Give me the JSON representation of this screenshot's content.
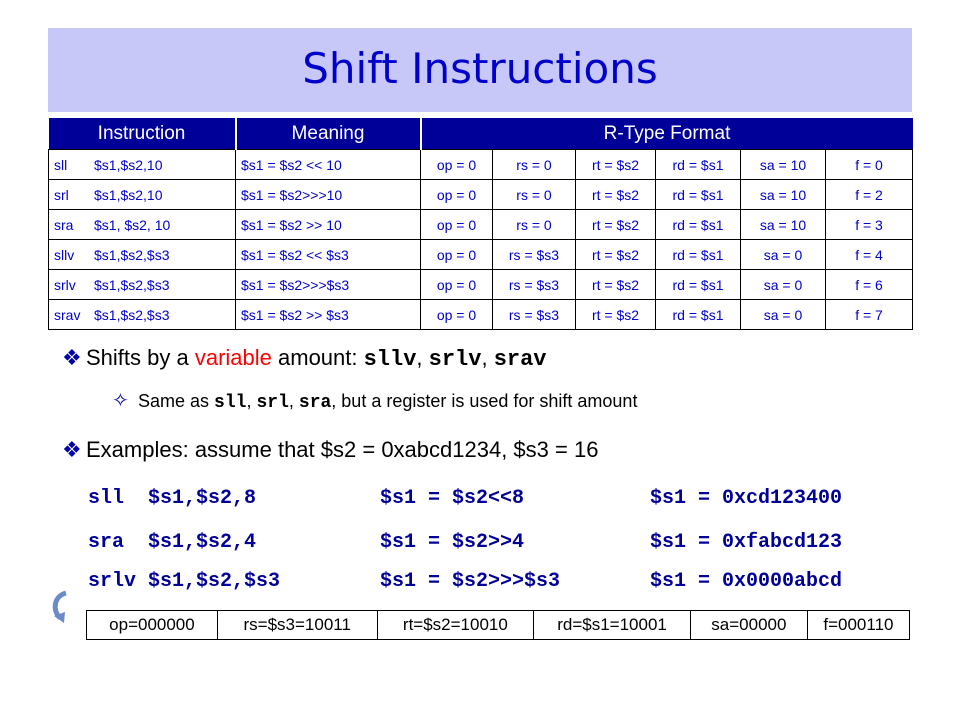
{
  "title": "Shift Instructions",
  "table": {
    "headers": [
      "Instruction",
      "Meaning",
      "R-Type Format"
    ],
    "rows": [
      {
        "mn": "sll",
        "ops": "$s1,$s2,10",
        "meaning": "$s1 = $s2 << 10",
        "op": "op = 0",
        "rs": "rs = 0",
        "rt": "rt = $s2",
        "rd": "rd = $s1",
        "sa": "sa = 10",
        "f": "f = 0"
      },
      {
        "mn": "srl",
        "ops": "$s1,$s2,10",
        "meaning": "$s1 = $s2>>>10",
        "op": "op = 0",
        "rs": "rs = 0",
        "rt": "rt = $s2",
        "rd": "rd = $s1",
        "sa": "sa = 10",
        "f": "f = 2"
      },
      {
        "mn": "sra",
        "ops": "$s1, $s2, 10",
        "meaning": "$s1 = $s2 >> 10",
        "op": "op = 0",
        "rs": "rs = 0",
        "rt": "rt = $s2",
        "rd": "rd = $s1",
        "sa": "sa = 10",
        "f": "f = 3"
      },
      {
        "mn": "sllv",
        "ops": "$s1,$s2,$s3",
        "meaning": "$s1 = $s2 << $s3",
        "op": "op = 0",
        "rs": "rs = $s3",
        "rt": "rt = $s2",
        "rd": "rd = $s1",
        "sa": "sa = 0",
        "f": "f = 4"
      },
      {
        "mn": "srlv",
        "ops": "$s1,$s2,$s3",
        "meaning": "$s1 = $s2>>>$s3",
        "op": "op = 0",
        "rs": "rs = $s3",
        "rt": "rt = $s2",
        "rd": "rd = $s1",
        "sa": "sa = 0",
        "f": "f = 6"
      },
      {
        "mn": "srav",
        "ops": "$s1,$s2,$s3",
        "meaning": "$s1 = $s2 >> $s3",
        "op": "op = 0",
        "rs": "rs = $s3",
        "rt": "rt = $s2",
        "rd": "rd = $s1",
        "sa": "sa = 0",
        "f": "f = 7"
      }
    ]
  },
  "bullet1": {
    "pre": "Shifts by a ",
    "red": "variable",
    "mid": " amount: ",
    "c1": "sllv",
    ", ": ", ",
    "sep": ", ",
    "c2": "srlv",
    "c3": "srav"
  },
  "sub1": {
    "pre": "Same as ",
    "c1": "sll",
    "sep": ", ",
    "c2": "srl",
    "c3": "sra",
    "post": ", but a register is used for shift amount"
  },
  "bullet2": "Examples: assume that $s2 = 0xabcd1234, $s3 = 16",
  "examples": [
    [
      "sll  $s1,$s2,8",
      "$s1 = $s2<<8",
      "$s1 = 0xcd123400"
    ],
    [
      "sra  $s1,$s2,4",
      "$s1 = $s2>>4",
      "$s1 = 0xfabcd123"
    ],
    [
      "srlv $s1,$s2,$s3",
      "$s1 = $s2>>>$s3",
      "$s1 = 0x0000abcd"
    ]
  ],
  "encoding": [
    "op=000000",
    "rs=$s3=10011",
    "rt=$s2=10010",
    "rd=$s1=10001",
    "sa=00000",
    "f=000110"
  ],
  "colors": {
    "title": "#0000cc",
    "title_bg": "#c8c8f8",
    "header_bg": "#000099",
    "accent_red": "#ff0000"
  }
}
